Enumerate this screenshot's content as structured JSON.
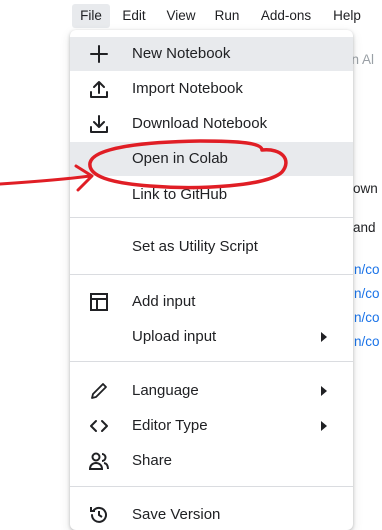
{
  "menubar": {
    "items": [
      "File",
      "Edit",
      "View",
      "Run",
      "Add-ons",
      "Help"
    ]
  },
  "background": {
    "fragment1": "un Al",
    "fragment2": "lown",
    "fragment3": "and",
    "links": [
      "n/co",
      "n/co",
      "n/co",
      "n/co"
    ]
  },
  "file_menu": {
    "items": [
      {
        "label": "New Notebook",
        "icon": "plus-icon"
      },
      {
        "label": "Import Notebook",
        "icon": "upload-icon"
      },
      {
        "label": "Download Notebook",
        "icon": "download-icon"
      },
      {
        "label": "Open in Colab",
        "icon": ""
      },
      {
        "label": "Link to GitHub",
        "icon": ""
      },
      {
        "label": "Set as Utility Script",
        "icon": ""
      },
      {
        "label": "Add input",
        "icon": "table-icon"
      },
      {
        "label": "Upload input",
        "icon": "",
        "submenu": true
      },
      {
        "label": "Language",
        "icon": "pencil-icon",
        "submenu": true
      },
      {
        "label": "Editor Type",
        "icon": "code-icon",
        "submenu": true
      },
      {
        "label": "Share",
        "icon": "people-icon"
      },
      {
        "label": "Save Version",
        "icon": "history-icon"
      }
    ]
  },
  "colors": {
    "annotation": "#e01e25",
    "highlight": "#e8eaed",
    "link": "#1a73e8"
  }
}
